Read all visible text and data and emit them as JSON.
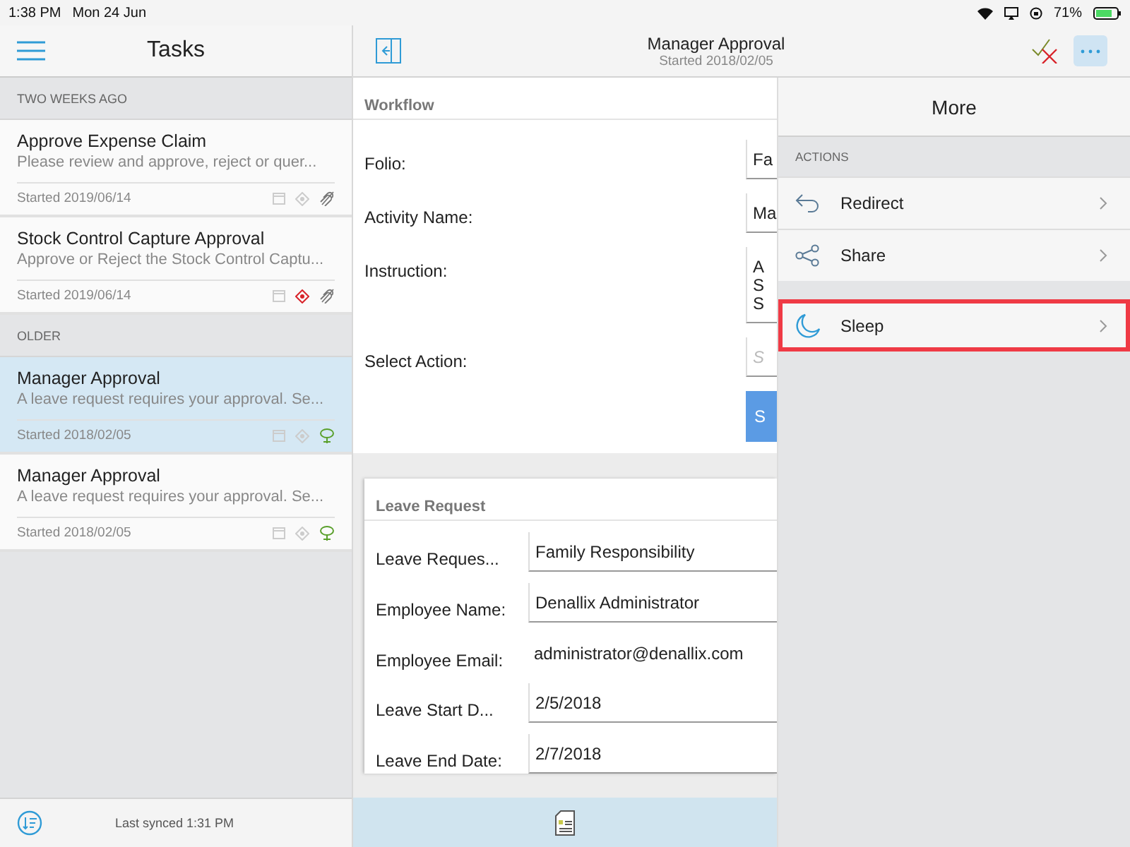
{
  "status_bar": {
    "time": "1:38 PM",
    "date": "Mon 24 Jun",
    "battery": "71%"
  },
  "tasks_panel": {
    "title": "Tasks",
    "footer": "Last synced 1:31 PM",
    "sections": [
      {
        "heading": "TWO WEEKS AGO",
        "items": [
          {
            "title": "Approve Expense Claim",
            "description": "Please review and approve, reject or quer...",
            "started": "Started 2019/06/14",
            "selected": false,
            "urgent": false,
            "kind": "offline"
          },
          {
            "title": "Stock Control Capture Approval",
            "description": "Approve or Reject the Stock Control Captu...",
            "started": "Started 2019/06/14",
            "selected": false,
            "urgent": true,
            "kind": "offline"
          }
        ]
      },
      {
        "heading": "OLDER",
        "items": [
          {
            "title": "Manager Approval",
            "description": "A leave request requires your approval. Se...",
            "started": "Started 2018/02/05",
            "selected": true,
            "urgent": false,
            "kind": "shared"
          },
          {
            "title": "Manager Approval",
            "description": "A leave request requires your approval. Se...",
            "started": "Started 2018/02/05",
            "selected": false,
            "urgent": false,
            "kind": "shared"
          }
        ]
      }
    ]
  },
  "detail_header": {
    "title": "Manager Approval",
    "subtitle": "Started 2018/02/05",
    "more_selected": true
  },
  "workflow": {
    "heading": "Workflow",
    "fields": [
      {
        "label": "Folio:",
        "kind": "value",
        "lines": [
          "Fa"
        ]
      },
      {
        "label": "Activity Name:",
        "kind": "value",
        "lines": [
          "Ma"
        ]
      },
      {
        "label": "Instruction:",
        "kind": "value",
        "lines": [
          "A",
          "S",
          "S"
        ]
      },
      {
        "label": "Select Action:",
        "kind": "placeholder",
        "lines": [
          "S"
        ]
      }
    ],
    "button": "S"
  },
  "leave_request": {
    "heading": "Leave Request",
    "fields": [
      {
        "label": "Leave Reques...",
        "value": "Family Responsibility",
        "underlined": true
      },
      {
        "label": "Employee Name:",
        "value": "Denallix Administrator",
        "underlined": true
      },
      {
        "label": "Employee Email:",
        "value": "administrator@denallix.com",
        "underlined": false
      },
      {
        "label": "Leave Start D...",
        "value": "2/5/2018",
        "underlined": true
      },
      {
        "label": "Leave End Date:",
        "value": "2/7/2018",
        "underlined": true
      }
    ]
  },
  "more_panel": {
    "title": "More",
    "section": "ACTIONS",
    "actions": [
      {
        "label": "Redirect",
        "kind": "redirect",
        "separated": false,
        "highlighted": false
      },
      {
        "label": "Share",
        "kind": "share",
        "separated": false,
        "highlighted": false
      },
      {
        "label": "Sleep",
        "kind": "sleep",
        "separated": true,
        "highlighted": true
      }
    ]
  }
}
